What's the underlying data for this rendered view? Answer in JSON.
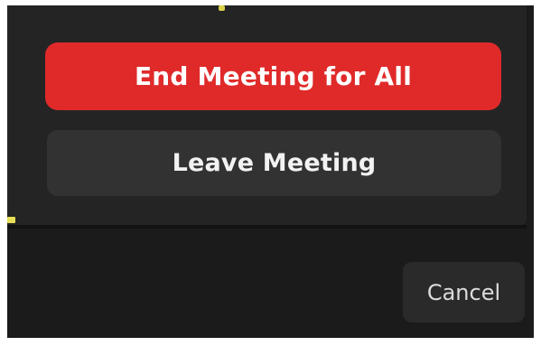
{
  "dialog": {
    "end_meeting_label": "End Meeting for All",
    "leave_meeting_label": "Leave Meeting",
    "cancel_label": "Cancel"
  },
  "colors": {
    "end_button": "#e02a2a",
    "leave_button": "#323232",
    "cancel_button": "#2a2a2a",
    "popup_background": "#242424",
    "window_background": "#1b1b1b"
  }
}
